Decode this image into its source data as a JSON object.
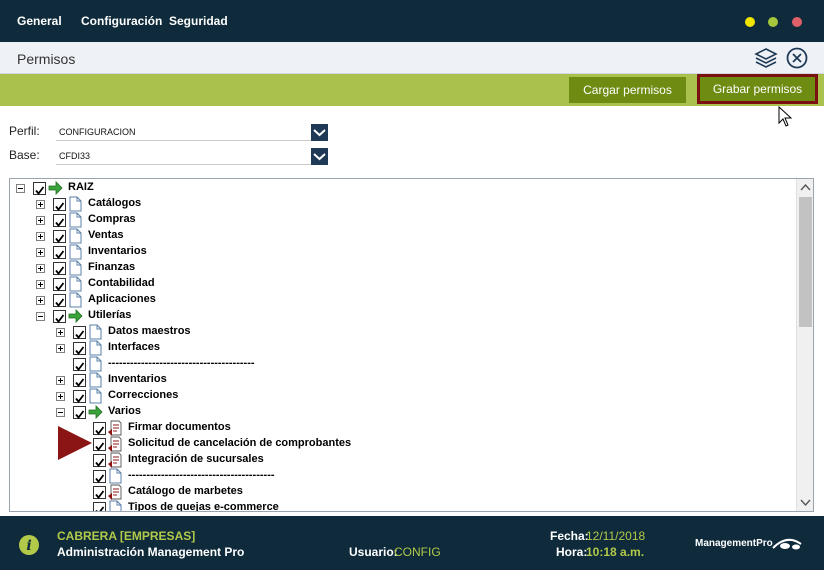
{
  "menu": [
    "General",
    "Configuración",
    "Seguridad"
  ],
  "window_controls": {
    "minimize_color": "#f2e500",
    "maximize_color": "#a6c63c",
    "close_color": "#e0606a"
  },
  "page": {
    "title": "Permisos"
  },
  "actions": {
    "cargar": "Cargar permisos",
    "grabar": "Grabar permisos"
  },
  "form": {
    "perfil_label": "Perfil:",
    "perfil_value": "CONFIGURACION",
    "base_label": "Base:",
    "base_value": "CFDI33"
  },
  "tree": [
    {
      "label": "RAIZ",
      "level": 0,
      "expander": "minus",
      "icon": "arrow-icon"
    },
    {
      "label": "Catálogos",
      "level": 1,
      "expander": "plus",
      "icon": "document-icon"
    },
    {
      "label": "Compras",
      "level": 1,
      "expander": "plus",
      "icon": "document-icon"
    },
    {
      "label": "Ventas",
      "level": 1,
      "expander": "plus",
      "icon": "document-icon"
    },
    {
      "label": "Inventarios",
      "level": 1,
      "expander": "plus",
      "icon": "document-icon"
    },
    {
      "label": "Finanzas",
      "level": 1,
      "expander": "plus",
      "icon": "document-icon"
    },
    {
      "label": "Contabilidad",
      "level": 1,
      "expander": "plus",
      "icon": "document-icon"
    },
    {
      "label": "Aplicaciones",
      "level": 1,
      "expander": "plus",
      "icon": "document-icon"
    },
    {
      "label": "Utilerías",
      "level": 1,
      "expander": "minus",
      "icon": "arrow-icon"
    },
    {
      "label": "Datos maestros",
      "level": 2,
      "expander": "plus",
      "icon": "document-icon"
    },
    {
      "label": "Interfaces",
      "level": 2,
      "expander": "plus",
      "icon": "document-icon"
    },
    {
      "label": "----------------------------------------",
      "level": 2,
      "expander": "none",
      "icon": "document-icon"
    },
    {
      "label": "Inventarios",
      "level": 2,
      "expander": "plus",
      "icon": "document-icon"
    },
    {
      "label": "Correcciones",
      "level": 2,
      "expander": "plus",
      "icon": "document-icon"
    },
    {
      "label": "Varios",
      "level": 2,
      "expander": "minus",
      "icon": "arrow-icon"
    },
    {
      "label": "Firmar documentos",
      "level": 3,
      "expander": "none",
      "icon": "report-icon"
    },
    {
      "label": "Solicitud de cancelación de comprobantes",
      "level": 3,
      "expander": "none",
      "icon": "report-icon"
    },
    {
      "label": "Integración de sucursales",
      "level": 3,
      "expander": "none",
      "icon": "report-icon"
    },
    {
      "label": "----------------------------------------",
      "level": 3,
      "expander": "none",
      "icon": "document-icon"
    },
    {
      "label": "Catálogo de marbetes",
      "level": 3,
      "expander": "none",
      "icon": "report-icon"
    },
    {
      "label": "Tipos de quejas e-commerce",
      "level": 3,
      "expander": "none",
      "icon": "document-icon"
    }
  ],
  "footer": {
    "company": "CABRERA [EMPRESAS]",
    "app": "Administración Management Pro",
    "usuario_label": "Usuario:",
    "usuario_value": "CONFIG",
    "fecha_label": "Fecha:",
    "fecha_value": "12/11/2018",
    "hora_label": "Hora:",
    "hora_value": "10:18 a.m.",
    "brand": "ManagementPro"
  }
}
